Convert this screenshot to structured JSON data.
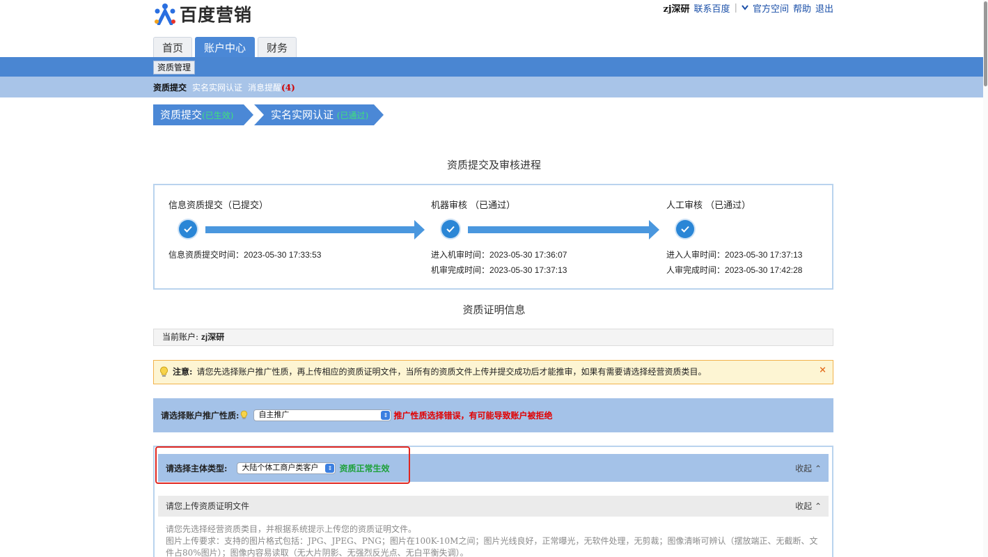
{
  "header": {
    "logo_text": "百度营销",
    "user": "zj深研",
    "links": [
      "联系百度",
      "官方空间",
      "帮助",
      "退出"
    ],
    "separator": "|",
    "chevron": "⌄"
  },
  "tabs": [
    {
      "label": "首页",
      "active": false
    },
    {
      "label": "账户中心",
      "active": true
    },
    {
      "label": "财务",
      "active": false
    }
  ],
  "subbar": {
    "button": "资质管理"
  },
  "subnav": {
    "current": "资质提交",
    "links": [
      "实名实网认证",
      "消息提醒"
    ],
    "message_count": "(4)"
  },
  "steps": [
    {
      "label": "资质提交",
      "status": "(已生效)"
    },
    {
      "label": "实名实网认证 ",
      "status": "(已通过)"
    }
  ],
  "process": {
    "title": "资质提交及审核进程",
    "stages": [
      {
        "title": "信息资质提交（已提交）",
        "times": [
          {
            "label": "信息资质提交时间：",
            "value": "2023-05-30 17:33:53"
          }
        ]
      },
      {
        "title": "机器审核 （已通过）",
        "times": [
          {
            "label": "进入机审时间：",
            "value": "2023-05-30 17:36:07"
          },
          {
            "label": "机审完成时间：",
            "value": "2023-05-30 17:37:13"
          }
        ]
      },
      {
        "title": "人工审核 （已通过）",
        "times": [
          {
            "label": "进入人审时间：",
            "value": "2023-05-30 17:37:13"
          },
          {
            "label": "人审完成时间：",
            "value": "2023-05-30 17:42:28"
          }
        ]
      }
    ]
  },
  "proof": {
    "title": "资质证明信息",
    "account_label": "当前账户: ",
    "account_value": "zj深研"
  },
  "notice": {
    "label": "注意: ",
    "text": "请您先选择账户推广性质，再上传相应的资质证明文件，当所有的资质文件上传并提交成功后才能推审，如果有需要请选择经营资质类目。",
    "close": "×"
  },
  "nature": {
    "label": "请选择账户推广性质: ",
    "selected": "自主推广",
    "warning": "推广性质选择错误，有可能导致账户被拒绝"
  },
  "subject": {
    "label": "请选择主体类型: ",
    "selected": "大陆个体工商户类客户",
    "status": "资质正常生效",
    "collapse": "收起"
  },
  "upload": {
    "title": "请您上传资质证明文件",
    "collapse": "收起",
    "line1": "请您先选择经营资质类目，并根据系统提示上传您的资质证明文件。",
    "line2": "图片上传要求：支持的图片格式包括：JPG、JPEG、PNG；图片在100K-10M之间；图片光线良好，正常曝光，无软件处理，无剪裁；图像清晰可辨认（摆放端正、无截断、文件占80%图片）；图像内容易读取（无大片阴影、无强烈反光点、无白平衡失调）。"
  },
  "colors": {
    "primary_blue": "#4a86d2",
    "light_blue": "#a4c2e8",
    "warning_red": "#e20000",
    "success_green": "#1ea13a",
    "highlight_red": "#e0261f"
  }
}
